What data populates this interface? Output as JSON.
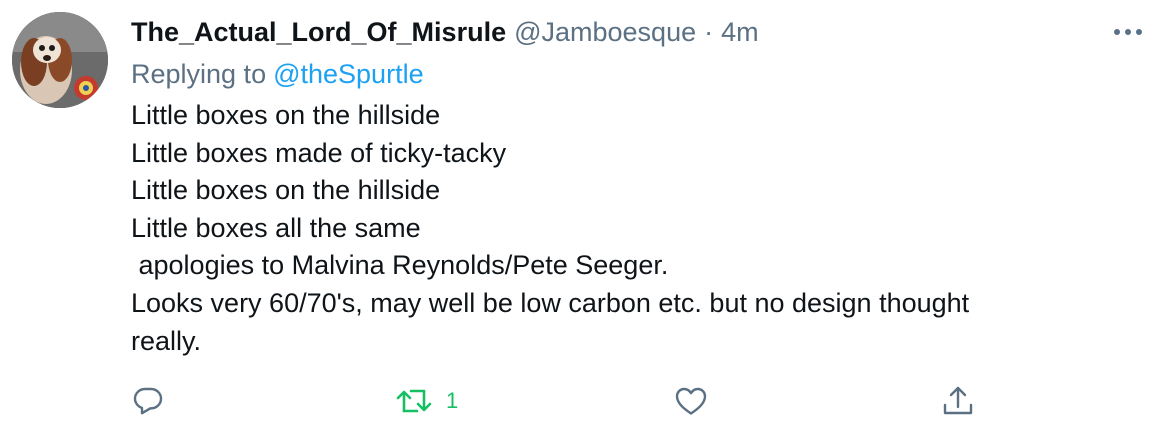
{
  "tweet": {
    "display_name": "The_Actual_Lord_Of_Misrule",
    "handle": "@Jamboesque",
    "separator": "·",
    "timestamp": "4m",
    "replying_to_label": "Replying to",
    "replying_to_handle": "@theSpurtle",
    "lines": [
      "Little boxes on the hillside",
      "Little boxes made of ticky-tacky",
      "Little boxes on the hillside",
      "Little boxes all the same",
      " apologies to Malvina Reynolds/Pete Seeger.",
      "Looks very 60/70's, may well be low carbon etc. but no design thought",
      "really."
    ]
  },
  "actions": {
    "reply_icon": "reply-icon",
    "retweet_icon": "retweet-icon",
    "retweet_count": "1",
    "like_icon": "heart-icon",
    "share_icon": "share-icon"
  },
  "colors": {
    "text": "#0f1419",
    "secondary": "#5b7083",
    "link": "#1da1f2",
    "retweet": "#17bf63"
  }
}
